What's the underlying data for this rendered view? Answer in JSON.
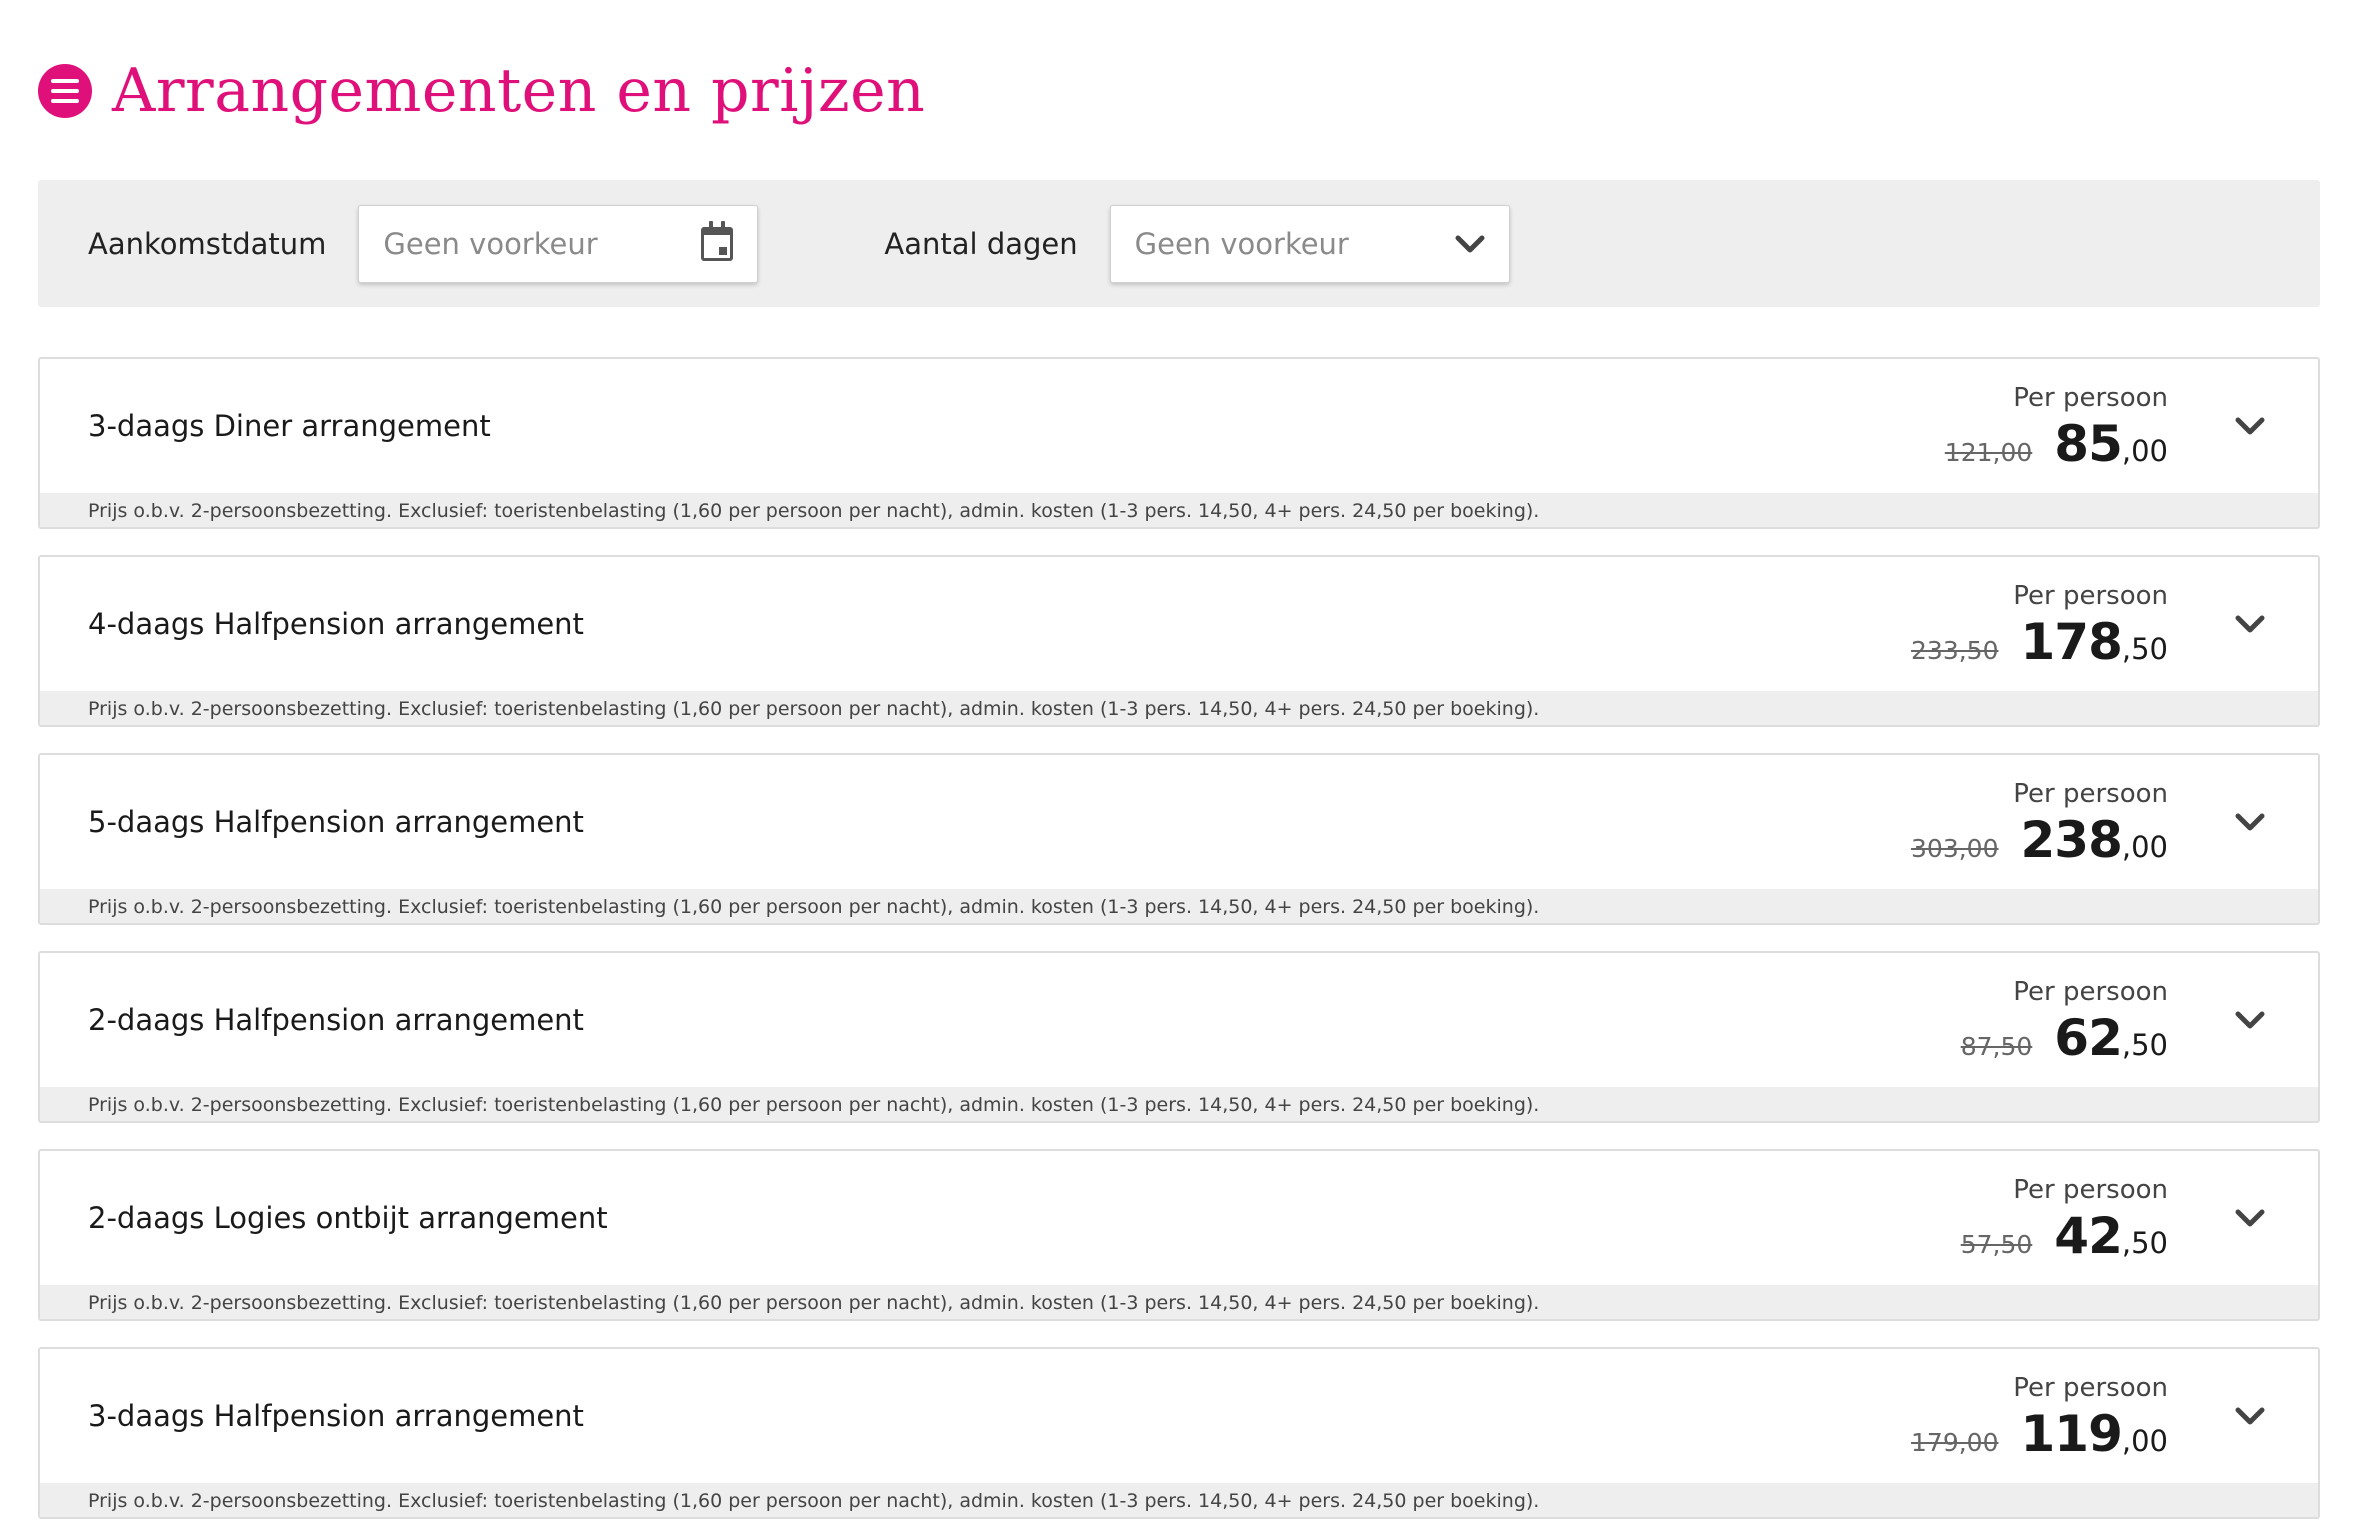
{
  "header": {
    "title": "Arrangementen en prijzen",
    "menu_icon": "menu-icon",
    "accent_color": "#e0107a"
  },
  "filters": {
    "arrival": {
      "label": "Aankomstdatum",
      "value": "Geen voorkeur",
      "icon": "calendar-icon"
    },
    "days": {
      "label": "Aantal dagen",
      "value": "Geen voorkeur",
      "icon": "chevron-down-icon"
    }
  },
  "packages": [
    {
      "name": "3-daags Diner arrangement",
      "per_person": "Per persoon",
      "old_price": "121,00",
      "price_int": "85",
      "price_dec": ",00",
      "note": "Prijs o.b.v. 2-persoonsbezetting. Exclusief: toeristenbelasting (1,60 per persoon per nacht), admin. kosten (1-3 pers. 14,50, 4+ pers. 24,50 per boeking)."
    },
    {
      "name": "4-daags Halfpension arrangement",
      "per_person": "Per persoon",
      "old_price": "233,50",
      "price_int": "178",
      "price_dec": ",50",
      "note": "Prijs o.b.v. 2-persoonsbezetting. Exclusief: toeristenbelasting (1,60 per persoon per nacht), admin. kosten (1-3 pers. 14,50, 4+ pers. 24,50 per boeking)."
    },
    {
      "name": "5-daags Halfpension arrangement",
      "per_person": "Per persoon",
      "old_price": "303,00",
      "price_int": "238",
      "price_dec": ",00",
      "note": "Prijs o.b.v. 2-persoonsbezetting. Exclusief: toeristenbelasting (1,60 per persoon per nacht), admin. kosten (1-3 pers. 14,50, 4+ pers. 24,50 per boeking)."
    },
    {
      "name": "2-daags Halfpension arrangement",
      "per_person": "Per persoon",
      "old_price": "87,50",
      "price_int": "62",
      "price_dec": ",50",
      "note": "Prijs o.b.v. 2-persoonsbezetting. Exclusief: toeristenbelasting (1,60 per persoon per nacht), admin. kosten (1-3 pers. 14,50, 4+ pers. 24,50 per boeking)."
    },
    {
      "name": "2-daags Logies ontbijt arrangement",
      "per_person": "Per persoon",
      "old_price": "57,50",
      "price_int": "42",
      "price_dec": ",50",
      "note": "Prijs o.b.v. 2-persoonsbezetting. Exclusief: toeristenbelasting (1,60 per persoon per nacht), admin. kosten (1-3 pers. 14,50, 4+ pers. 24,50 per boeking)."
    },
    {
      "name": "3-daags Halfpension arrangement",
      "per_person": "Per persoon",
      "old_price": "179,00",
      "price_int": "119",
      "price_dec": ",00",
      "note": "Prijs o.b.v. 2-persoonsbezetting. Exclusief: toeristenbelasting (1,60 per persoon per nacht), admin. kosten (1-3 pers. 14,50, 4+ pers. 24,50 per boeking)."
    }
  ]
}
